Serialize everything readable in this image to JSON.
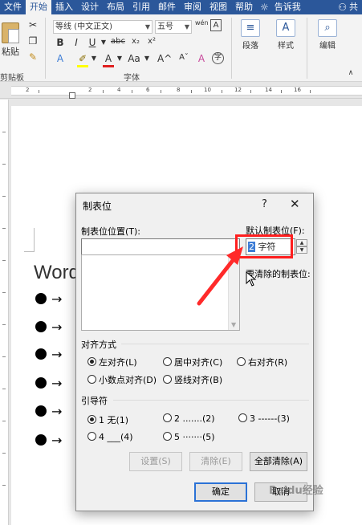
{
  "tabs": [
    {
      "label": "文件",
      "active": false
    },
    {
      "label": "开始",
      "active": true
    },
    {
      "label": "插入",
      "active": false
    },
    {
      "label": "设计",
      "active": false
    },
    {
      "label": "布局",
      "active": false
    },
    {
      "label": "引用",
      "active": false
    },
    {
      "label": "邮件",
      "active": false
    },
    {
      "label": "审阅",
      "active": false
    },
    {
      "label": "视图",
      "active": false
    },
    {
      "label": "帮助",
      "active": false
    }
  ],
  "tell_me": "告诉我",
  "share_partial": "共",
  "ribbon": {
    "paste_label": "粘贴",
    "clipboard_label": "剪贴板",
    "font_name": "等线 (中文正文)",
    "font_size": "五号",
    "font_group_label": "字体",
    "paragraph_label": "段落",
    "styles_label": "样式",
    "editing_label": "编辑",
    "bold": "B",
    "italic": "I",
    "underline": "U",
    "strike": "abc",
    "sub": "x₂",
    "sup": "x²",
    "wen": "wén",
    "a_char": "A",
    "grow": "A^",
    "shrink": "Aˇ",
    "aa": "Aa",
    "clear_fmt": "A",
    "circled": "字"
  },
  "ruler": {
    "numbers": [
      "2",
      "2",
      "4",
      "6",
      "8",
      "10",
      "12",
      "14",
      "16"
    ]
  },
  "document": {
    "title_partial": "Word",
    "bullet_count": 6
  },
  "dialog": {
    "title": "制表位",
    "help": "?",
    "close": "✕",
    "tab_position_label": "制表位位置(T):",
    "tab_position_value": "",
    "default_tab_label": "默认制表位(F):",
    "default_tab_number": "2",
    "default_tab_unit": " 字符",
    "to_clear_label": "要清除的制表位:",
    "alignment_label": "对齐方式",
    "alignment_options": [
      {
        "label": "左对齐(L)",
        "checked": true
      },
      {
        "label": "居中对齐(C)",
        "checked": false
      },
      {
        "label": "右对齐(R)",
        "checked": false
      },
      {
        "label": "小数点对齐(D)",
        "checked": false
      },
      {
        "label": "竖线对齐(B)",
        "checked": false
      }
    ],
    "leader_label": "引导符",
    "leader_options": [
      {
        "label": "1 无(1)",
        "checked": true
      },
      {
        "label": "2 .......(2)",
        "checked": false
      },
      {
        "label": "3 ------(3)",
        "checked": false
      },
      {
        "label": "4 ___(4)",
        "checked": false
      },
      {
        "label": "5 ·······(5)",
        "checked": false
      }
    ],
    "set_button": "设置(S)",
    "clear_button": "清除(E)",
    "clear_all_button": "全部清除(A)",
    "ok_button": "确定",
    "cancel_button": "取消"
  },
  "colors": {
    "accent": "#2b579a",
    "highlight": "#ff1f1f",
    "selection": "#3d7dd6"
  },
  "watermark": "Baidu经验"
}
